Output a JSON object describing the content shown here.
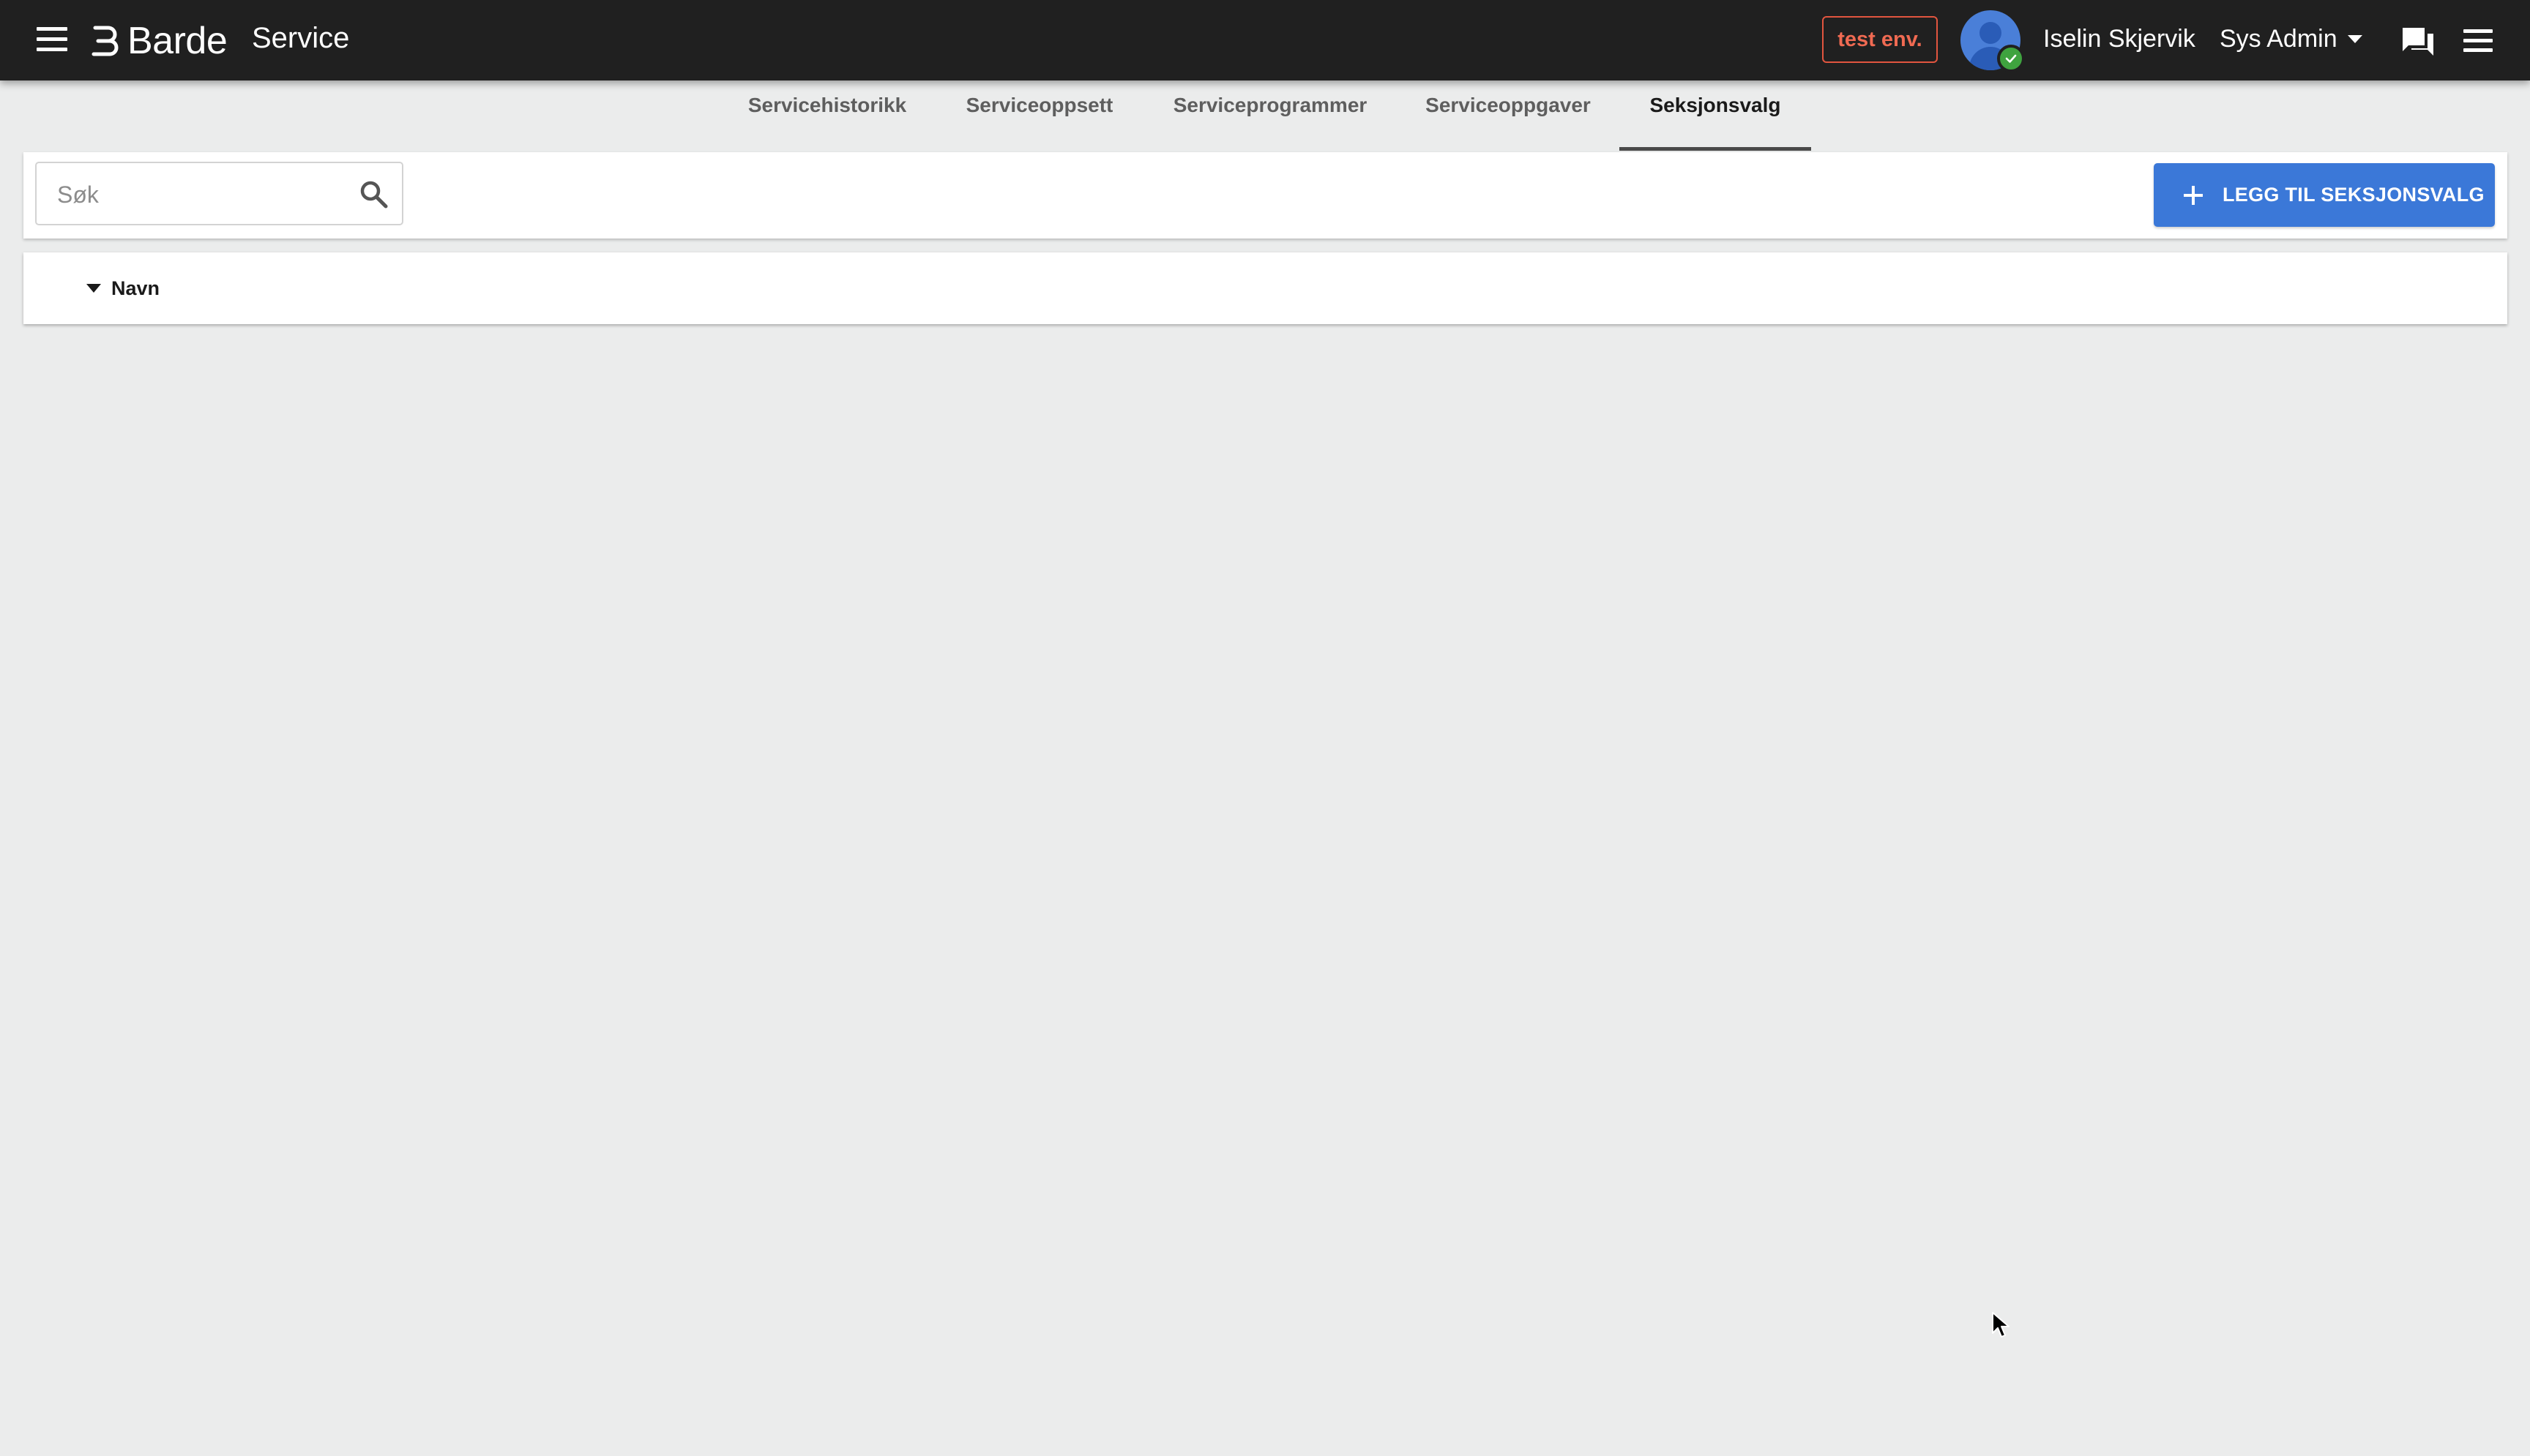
{
  "header": {
    "brand": "Barde",
    "app_title": "Service",
    "env_badge": "test env.",
    "user_name": "Iselin Skjervik",
    "role": "Sys Admin",
    "colors": {
      "bar_background": "#202020",
      "env_badge": "#e2553f",
      "status_online": "#3fa33f"
    },
    "icons": [
      "menu-icon",
      "barde-logo",
      "avatar-icon",
      "check-icon",
      "chevron-down-icon",
      "chat-icon",
      "menu-icon"
    ]
  },
  "tabs": [
    {
      "label": "Servicehistorikk",
      "active": false
    },
    {
      "label": "Serviceoppsett",
      "active": false
    },
    {
      "label": "Serviceprogrammer",
      "active": false
    },
    {
      "label": "Serviceoppgaver",
      "active": false
    },
    {
      "label": "Seksjonsvalg",
      "active": true
    }
  ],
  "toolbar": {
    "search": {
      "placeholder": "Søk",
      "value": ""
    },
    "add_button_label": "LEGG TIL SEKSJONSVALG",
    "add_button_color": "#3b78d8"
  },
  "table": {
    "columns": [
      {
        "label": "Navn",
        "sort": "descending"
      }
    ],
    "rows": []
  }
}
